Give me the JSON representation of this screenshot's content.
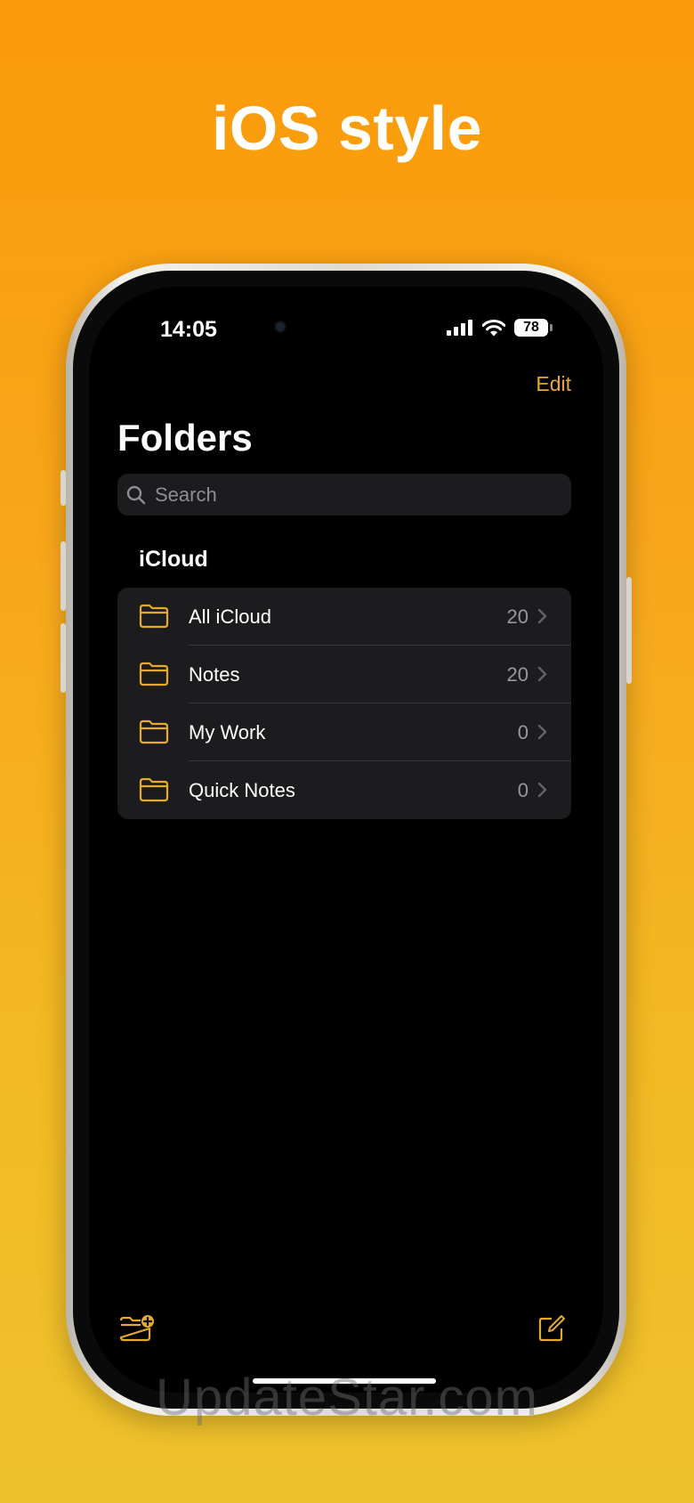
{
  "headline": "iOS style",
  "status_bar": {
    "time": "14:05",
    "battery": "78"
  },
  "nav": {
    "edit_label": "Edit",
    "title": "Folders"
  },
  "search": {
    "placeholder": "Search"
  },
  "section": {
    "title": "iCloud"
  },
  "folders": [
    {
      "name": "All iCloud",
      "count": "20"
    },
    {
      "name": "Notes",
      "count": "20"
    },
    {
      "name": "My Work",
      "count": "0"
    },
    {
      "name": "Quick Notes",
      "count": "0"
    }
  ],
  "toolbar": {
    "new_folder_icon": "folder-plus-icon",
    "compose_icon": "compose-icon"
  },
  "watermark": "UpdateStar.com",
  "colors": {
    "accent": "#e5a92b",
    "background_top": "#fb9a08",
    "background_bottom": "#eec22c",
    "screen": "#000000",
    "grouped_cell": "#1c1c1e"
  }
}
